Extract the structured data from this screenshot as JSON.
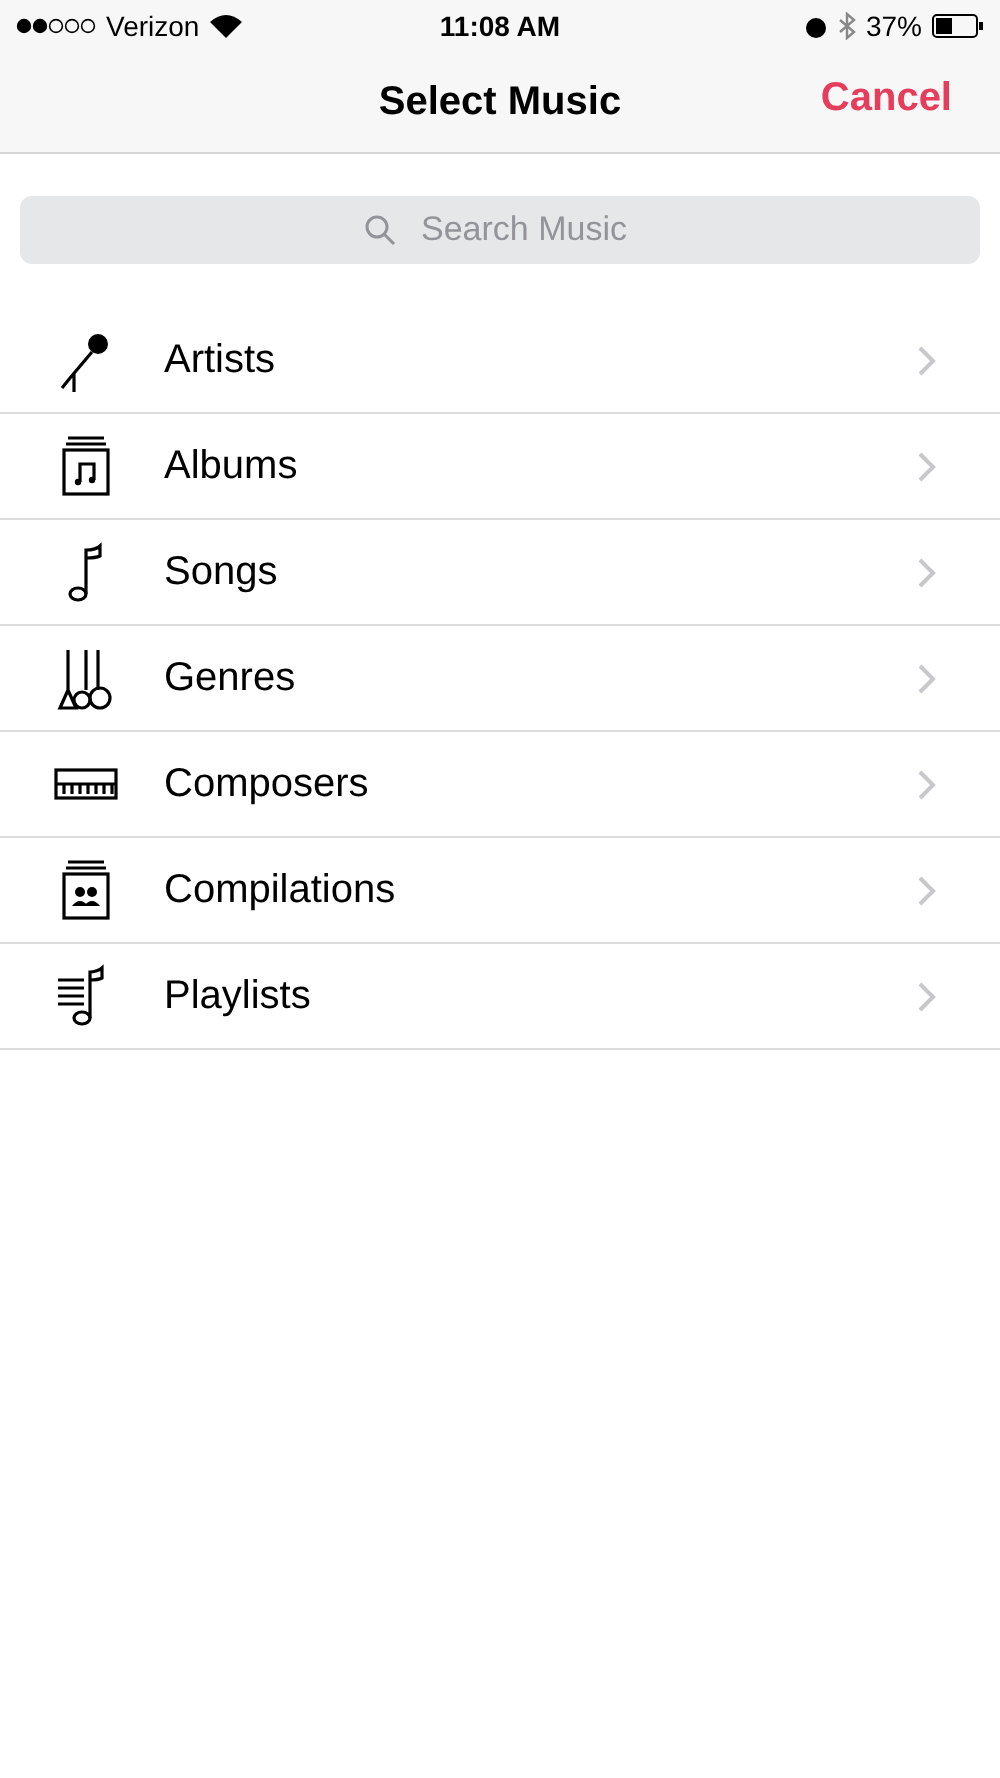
{
  "status_bar": {
    "carrier": "Verizon",
    "time": "11:08 AM",
    "battery_percent": "37%"
  },
  "nav": {
    "title": "Select Music",
    "cancel": "Cancel"
  },
  "search": {
    "placeholder": "Search Music"
  },
  "items": [
    {
      "kind": "artists",
      "label": "Artists"
    },
    {
      "kind": "albums",
      "label": "Albums"
    },
    {
      "kind": "songs",
      "label": "Songs"
    },
    {
      "kind": "genres",
      "label": "Genres"
    },
    {
      "kind": "composers",
      "label": "Composers"
    },
    {
      "kind": "compilations",
      "label": "Compilations"
    },
    {
      "kind": "playlists",
      "label": "Playlists"
    }
  ]
}
